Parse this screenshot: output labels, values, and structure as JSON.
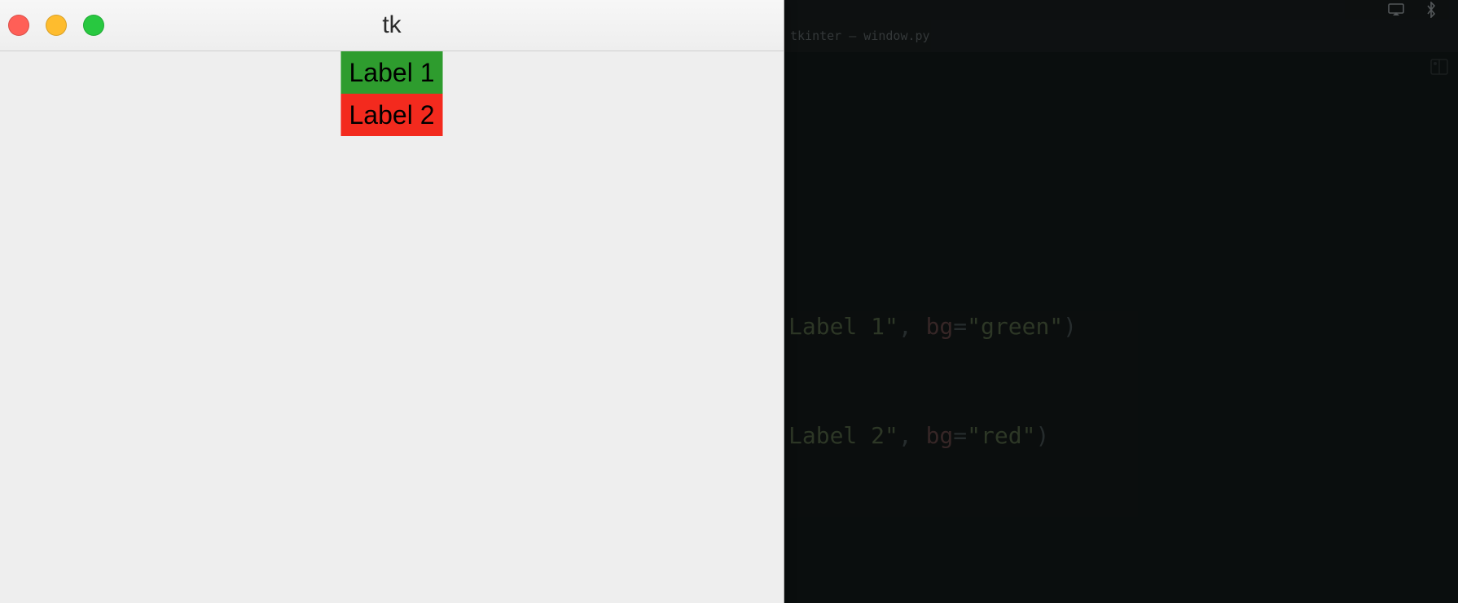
{
  "window": {
    "title": "tk"
  },
  "labels": [
    {
      "text": "Label 1",
      "bg": "green"
    },
    {
      "text": "Label 2",
      "bg": "red"
    }
  ],
  "editor": {
    "tab_filename": "tkinter – window.py",
    "code_lines": [
      {
        "parts": [
          {
            "t": "Label 1\"",
            "cls": "tok-string"
          },
          {
            "t": ", ",
            "cls": "tok-plain"
          },
          {
            "t": "bg",
            "cls": "tok-kw"
          },
          {
            "t": "=",
            "cls": "tok-plain"
          },
          {
            "t": "\"green\"",
            "cls": "tok-string"
          },
          {
            "t": ")",
            "cls": "tok-plain"
          }
        ]
      },
      {
        "parts": [
          {
            "t": "Label 2\"",
            "cls": "tok-string"
          },
          {
            "t": ", ",
            "cls": "tok-plain"
          },
          {
            "t": "bg",
            "cls": "tok-kw"
          },
          {
            "t": "=",
            "cls": "tok-plain"
          },
          {
            "t": "\"red\"",
            "cls": "tok-string"
          },
          {
            "t": ")",
            "cls": "tok-plain"
          }
        ]
      }
    ]
  },
  "colors": {
    "green": "#2e9c2e",
    "red": "#f32a1e"
  }
}
